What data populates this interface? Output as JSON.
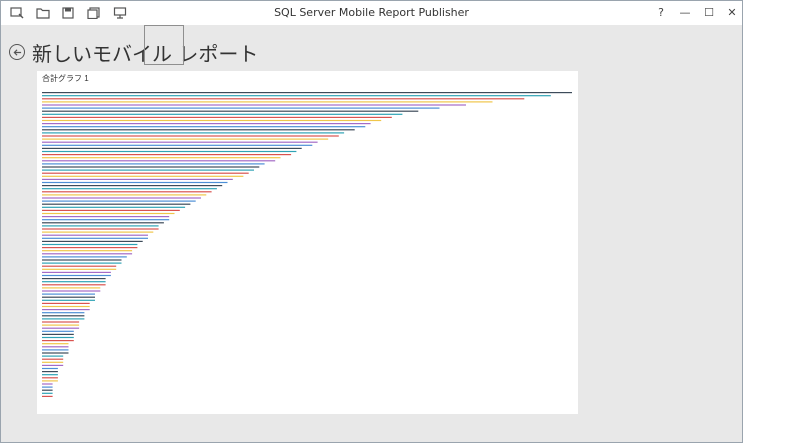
{
  "app": {
    "title": "SQL Server Mobile Report Publisher",
    "toolbar": [
      "new-report-icon",
      "open-icon",
      "save-icon",
      "save-as-icon",
      "publish-icon"
    ]
  },
  "window_controls": {
    "help": "?",
    "minimize": "—",
    "maximize": "☐",
    "close": "✕"
  },
  "page": {
    "title": "新しいモバイル レポート"
  },
  "chart_data": {
    "type": "bar",
    "orientation": "horizontal",
    "title": "合計グラフ 1",
    "colors": [
      "#3d4b5a",
      "#2fa3b5",
      "#d9534f",
      "#f0c64b",
      "#a56bc6",
      "#4c8fd6"
    ],
    "values": [
      100,
      96,
      91,
      85,
      80,
      75,
      71,
      68,
      66,
      64,
      62,
      61,
      59,
      57,
      56,
      54,
      52,
      51,
      49,
      48,
      47,
      45,
      44,
      42,
      41,
      40,
      39,
      38,
      36,
      35,
      34,
      33,
      32,
      31,
      30,
      29,
      28,
      27,
      26,
      25,
      24,
      24,
      23,
      22,
      22,
      21,
      20,
      20,
      19,
      18,
      18,
      17,
      17,
      16,
      15,
      15,
      14,
      14,
      13,
      13,
      12,
      12,
      12,
      11,
      11,
      10,
      10,
      10,
      9,
      9,
      9,
      8,
      8,
      8,
      7,
      7,
      7,
      6,
      6,
      6,
      6,
      5,
      5,
      5,
      5,
      4,
      4,
      4,
      4,
      3,
      3,
      3,
      3,
      3,
      2,
      2,
      2,
      2,
      2
    ]
  }
}
